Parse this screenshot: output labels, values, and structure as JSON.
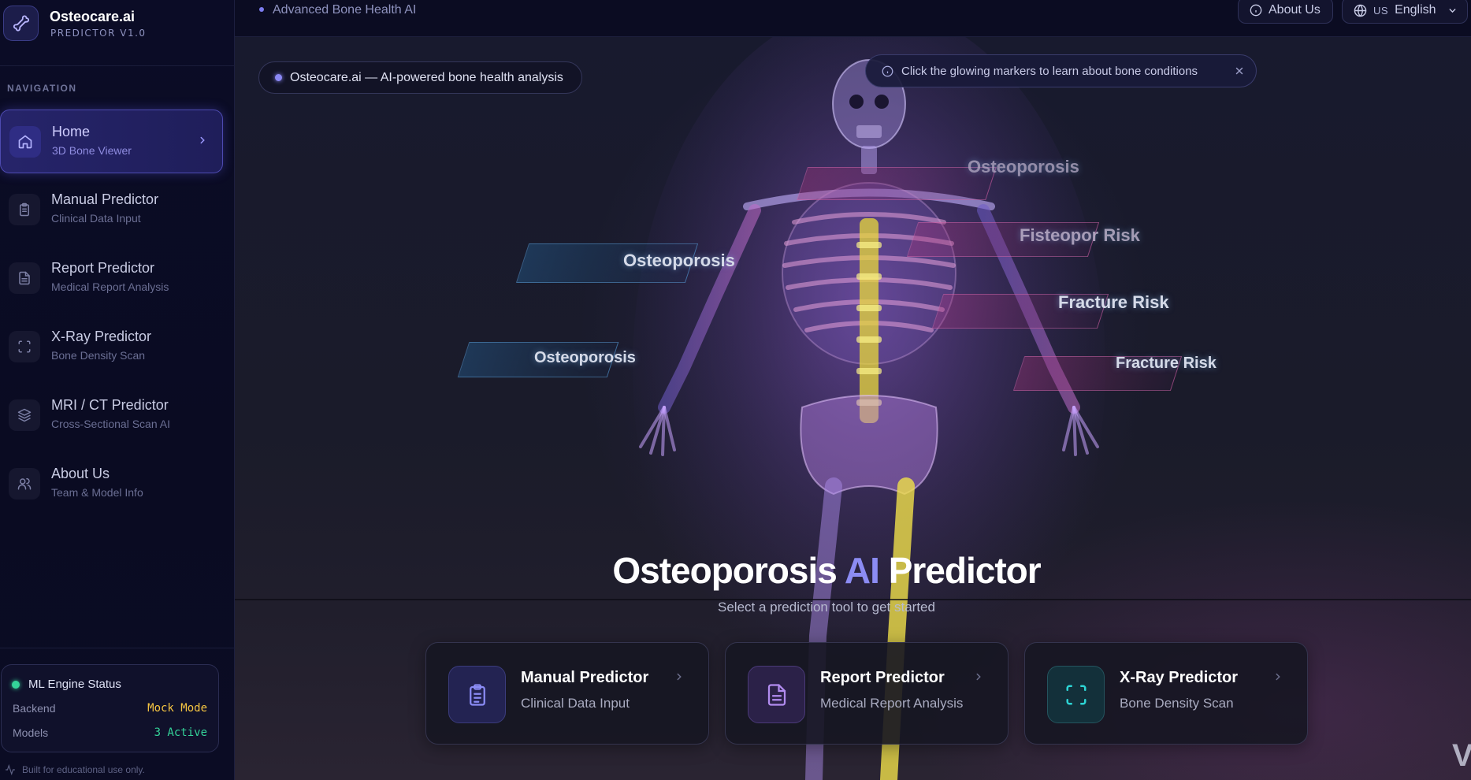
{
  "brand": {
    "title": "Osteocare.ai",
    "subtitle": "PREDICTOR V1.0",
    "icon": "bone-icon"
  },
  "sidebar": {
    "section_label": "NAVIGATION",
    "items": [
      {
        "title": "Home",
        "subtitle": "3D Bone Viewer",
        "icon": "home-icon",
        "active": true
      },
      {
        "title": "Manual Predictor",
        "subtitle": "Clinical Data Input",
        "icon": "clipboard-icon"
      },
      {
        "title": "Report Predictor",
        "subtitle": "Medical Report Analysis",
        "icon": "document-icon"
      },
      {
        "title": "X-Ray Predictor",
        "subtitle": "Bone Density Scan",
        "icon": "scan-icon"
      },
      {
        "title": "MRI / CT Predictor",
        "subtitle": "Cross-Sectional Scan AI",
        "icon": "layers-icon"
      },
      {
        "title": "About Us",
        "subtitle": "Team & Model Info",
        "icon": "users-icon"
      }
    ],
    "status": {
      "title": "ML Engine Status",
      "backend_label": "Backend",
      "backend_value": "Mock Mode",
      "models_label": "Models",
      "models_value": "3 Active"
    },
    "footer": "Built for educational use only."
  },
  "topbar": {
    "title": "Advanced Bone Health AI",
    "about_label": "About Us",
    "lang_code": "US",
    "lang_label": "English"
  },
  "hero": {
    "pill": "Osteocare.ai — AI-powered bone health analysis",
    "tip": "Click the glowing markers to learn about bone conditions",
    "labels": [
      "Osteoporosis",
      "Osteoporosis",
      "Osteoporosis",
      "Fisteopor Risk",
      "Fracture Risk",
      "Fracture Risk"
    ],
    "title_part1": "Osteoporosis",
    "title_accent": "AI",
    "title_part2": "Predictor",
    "subtitle": "Select a prediction tool to get started",
    "watermark": "V"
  },
  "cards": [
    {
      "title": "Manual Predictor",
      "subtitle": "Clinical Data Input",
      "icon": "clipboard-icon",
      "accent": "#8b8cf5"
    },
    {
      "title": "Report Predictor",
      "subtitle": "Medical Report Analysis",
      "icon": "document-icon",
      "accent": "#b28cf0"
    },
    {
      "title": "X-Ray Predictor",
      "subtitle": "Bone Density Scan",
      "icon": "scan-icon",
      "accent": "#2dd4d4"
    }
  ],
  "colors": {
    "accent": "#8c8cf3",
    "success": "#34d399",
    "warning": "#f5c542"
  }
}
